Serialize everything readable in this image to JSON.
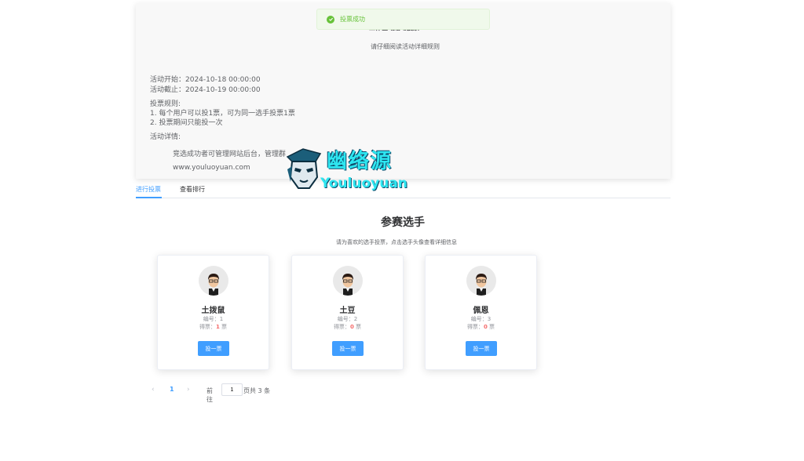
{
  "toast": {
    "text": "投票成功"
  },
  "activity": {
    "hidden_title": "工作区域活动投票",
    "subtitle": "请仔细阅读活动详细规则",
    "start": "活动开始：2024-10-18 00:00:00",
    "end": "活动截止：2024-10-19 00:00:00",
    "rules_label": "投票规则:",
    "rule1": "1. 每个用户可以投1票，可为同一选手投票1票",
    "rule2": "2. 投票期间只能投一次",
    "detail_label": "活动详情:",
    "detail1": "竞选成功者可管理网站后台，管理群",
    "detail2": "www.youluoyuan.com"
  },
  "watermark": {
    "title": "幽络源",
    "sub": "Youluoyuan"
  },
  "tabs": [
    {
      "label": "进行投票"
    },
    {
      "label": "查看排行"
    }
  ],
  "section": {
    "title": "参赛选手",
    "hint": "请为喜欢的选手投票，点击选手头像查看详细信息"
  },
  "candidates": [
    {
      "name": "土拨鼠",
      "id_label": "编号：",
      "id": "1",
      "votes_label": "得票：",
      "votes": "1",
      "unit": "票",
      "button": "投一票"
    },
    {
      "name": "土豆",
      "id_label": "编号：",
      "id": "2",
      "votes_label": "得票：",
      "votes": "0",
      "unit": "票",
      "button": "投一票"
    },
    {
      "name": "佩恩",
      "id_label": "编号：",
      "id": "3",
      "votes_label": "得票：",
      "votes": "0",
      "unit": "票",
      "button": "投一票"
    }
  ],
  "pager": {
    "prev": "‹",
    "page": "1",
    "next": "›",
    "goto": "前往",
    "jump_value": "1",
    "total": "页共 3 条"
  },
  "colors": {
    "primary": "#409eff",
    "success": "#67c23a",
    "danger": "#f56c6c"
  }
}
